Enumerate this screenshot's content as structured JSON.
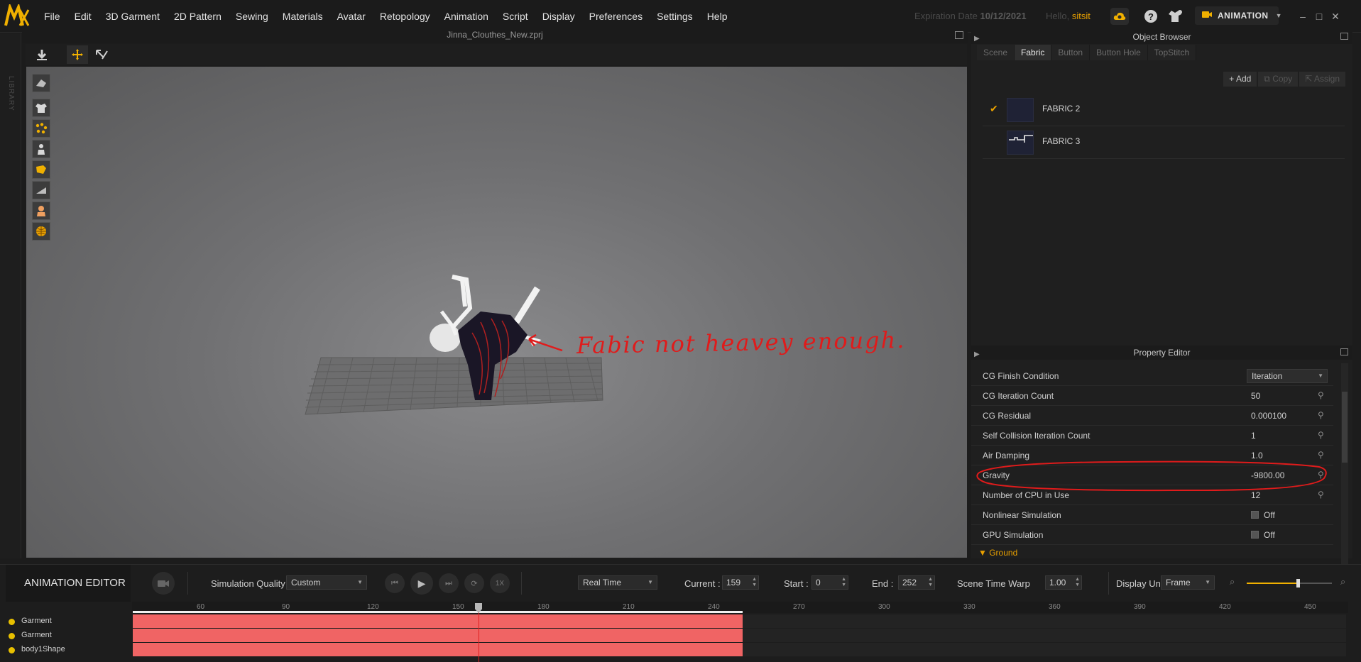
{
  "menu": {
    "items": [
      "File",
      "Edit",
      "3D Garment",
      "2D Pattern",
      "Sewing",
      "Materials",
      "Avatar",
      "Retopology",
      "Animation",
      "Script",
      "Display",
      "Preferences",
      "Settings",
      "Help"
    ]
  },
  "header": {
    "expiration_label": "Expiration Date",
    "expiration_date": "10/12/2021",
    "hello_label": "Hello,",
    "username": "sitsit",
    "mode_label": "ANIMATION"
  },
  "library": {
    "label": "LIBRARY"
  },
  "viewport": {
    "title": "Jinna_Clouthes_New.zprj",
    "annotation": "Fabic not heavey enough."
  },
  "object_browser": {
    "title": "Object Browser",
    "tabs": [
      "Scene",
      "Fabric",
      "Button",
      "Button Hole",
      "TopStitch"
    ],
    "active_tab": "Fabric",
    "actions": {
      "add": "Add",
      "copy": "Copy",
      "assign": "Assign"
    },
    "fabrics": [
      {
        "name": "FABRIC 2",
        "selected": true
      },
      {
        "name": "FABRIC 3",
        "selected": false
      }
    ]
  },
  "property_editor": {
    "title": "Property Editor",
    "rows": [
      {
        "label": "CG Finish Condition",
        "value": "Iteration",
        "kind": "select"
      },
      {
        "label": "CG Iteration Count",
        "value": "50",
        "kind": "value"
      },
      {
        "label": "CG Residual",
        "value": "0.000100",
        "kind": "value"
      },
      {
        "label": "Self Collision Iteration Count",
        "value": "1",
        "kind": "value"
      },
      {
        "label": "Air Damping",
        "value": "1.0",
        "kind": "value"
      },
      {
        "label": "Gravity",
        "value": "-9800.00",
        "kind": "value"
      },
      {
        "label": "Number of CPU in Use",
        "value": "12",
        "kind": "value"
      },
      {
        "label": "Nonlinear Simulation",
        "value": "Off",
        "kind": "check"
      },
      {
        "label": "GPU Simulation",
        "value": "Off",
        "kind": "check"
      }
    ],
    "section": "Ground"
  },
  "animation_editor": {
    "title": "ANIMATION EDITOR",
    "simulation_quality_label": "Simulation Quality",
    "simulation_quality": "Custom",
    "speed": "1X",
    "playback_mode": "Real Time",
    "current_label": "Current :",
    "current": "159",
    "start_label": "Start :",
    "start": "0",
    "end_label": "End :",
    "end": "252",
    "time_warp_label": "Scene Time Warp",
    "time_warp": "1.00",
    "display_unit_label": "Display Unit",
    "display_unit": "Frame",
    "ticks": [
      "60",
      "90",
      "120",
      "150",
      "180",
      "210",
      "240",
      "270",
      "300",
      "330",
      "360",
      "390",
      "420",
      "450"
    ],
    "tracks": [
      "Garment",
      "Garment",
      "body1Shape"
    ]
  },
  "colors": {
    "accent": "#e8a000",
    "track_fill": "#f06464",
    "annotation": "#e01b1b"
  }
}
